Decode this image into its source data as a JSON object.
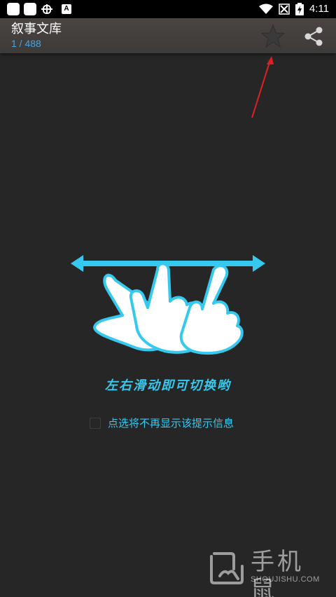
{
  "status_bar": {
    "time": "4:11",
    "notification_icons": [
      "app-square-icon",
      "app-square-icon",
      "bug-icon",
      "a-icon"
    ],
    "system_icons": [
      "wifi-icon",
      "no-sim-icon",
      "battery-charging-icon"
    ]
  },
  "app_bar": {
    "title": "叙事文库",
    "subtitle": "1 / 488",
    "actions": [
      "star-icon",
      "share-icon"
    ]
  },
  "overlay": {
    "hint": "左右滑动即可切换哟",
    "dont_show_again": "点选将不再显示该提示信息",
    "dont_show_checked": false
  },
  "watermark": {
    "text": "手机鼠",
    "sub": "SHOUJISHU.COM"
  },
  "colors": {
    "background": "#262626",
    "app_bar": "#433f3d",
    "subtitle": "#4aa3df",
    "accent": "#35c9ef",
    "annotation_arrow": "#e02020"
  }
}
